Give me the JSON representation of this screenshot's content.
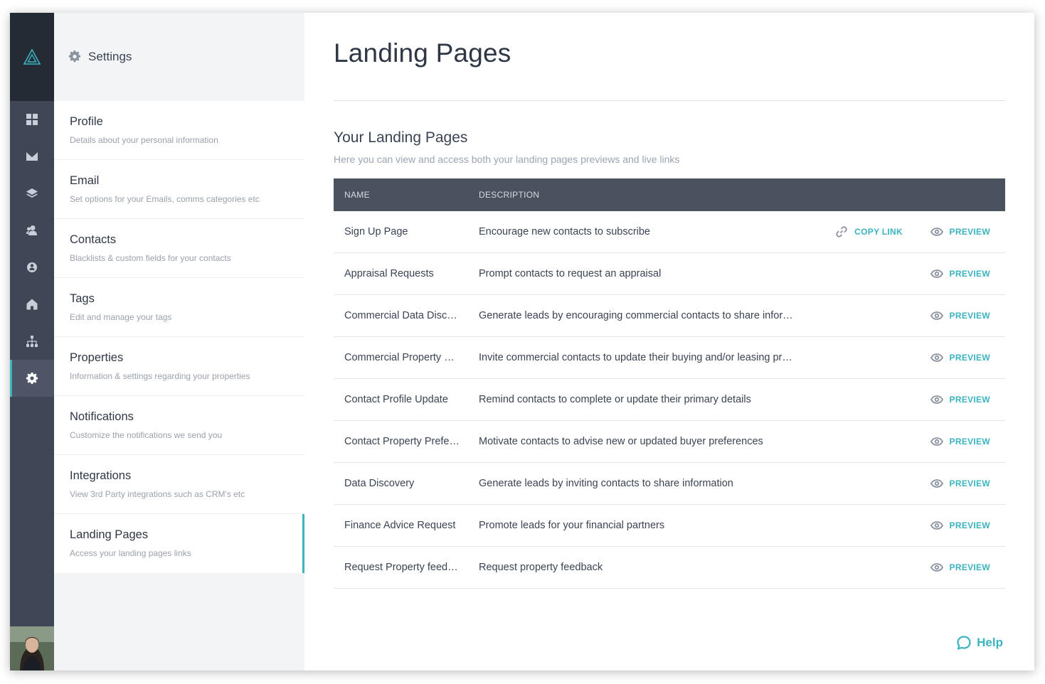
{
  "rail": {
    "icons": [
      "logo-icon",
      "dashboard-icon",
      "mail-icon",
      "layers-icon",
      "contacts-icon",
      "groups-icon",
      "home-icon",
      "hierarchy-icon",
      "gear-icon"
    ],
    "active": "gear-icon"
  },
  "sidebar": {
    "header": "Settings",
    "items": [
      {
        "title": "Profile",
        "desc": "Details about your personal information"
      },
      {
        "title": "Email",
        "desc": "Set options for your Emails, comms categories etc"
      },
      {
        "title": "Contacts",
        "desc": "Blacklists & custom fields for your contacts"
      },
      {
        "title": "Tags",
        "desc": "Edit and manage your tags"
      },
      {
        "title": "Properties",
        "desc": "Information & settings regarding your properties"
      },
      {
        "title": "Notifications",
        "desc": "Customize the notifications we send you"
      },
      {
        "title": "Integrations",
        "desc": "View 3rd Party integrations such as CRM's etc"
      },
      {
        "title": "Landing Pages",
        "desc": "Access your landing pages links"
      }
    ]
  },
  "main": {
    "title": "Landing Pages",
    "section_title": "Your Landing Pages",
    "section_sub": "Here you can view and access both your landing pages previews and live links",
    "columns": [
      "NAME",
      "DESCRIPTION"
    ],
    "copy_link_label": "COPY LINK",
    "preview_label": "PREVIEW",
    "rows": [
      {
        "name": "Sign Up Page",
        "desc": "Encourage new contacts to subscribe"
      },
      {
        "name": "Appraisal Requests",
        "desc": "Prompt contacts to request an appraisal"
      },
      {
        "name": "Commercial Data Disc…",
        "desc": "Generate leads by encouraging commercial contacts to share infor…"
      },
      {
        "name": "Commercial Property …",
        "desc": "Invite commercial contacts to update their buying and/or leasing pr…"
      },
      {
        "name": "Contact Profile Update",
        "desc": "Remind contacts to complete or update their primary details"
      },
      {
        "name": "Contact Property Prefe…",
        "desc": "Motivate contacts to advise new or updated buyer preferences"
      },
      {
        "name": "Data Discovery",
        "desc": "Generate leads by inviting contacts to share information"
      },
      {
        "name": "Finance Advice Request",
        "desc": "Promote leads for your financial partners"
      },
      {
        "name": "Request Property feed…",
        "desc": "Request property feedback"
      }
    ]
  },
  "help": {
    "label": "Help"
  },
  "colors": {
    "accent": "#3cb4c0",
    "rail": "#3f4756",
    "rail_dark": "#252b35",
    "table_header": "#4a5260"
  }
}
